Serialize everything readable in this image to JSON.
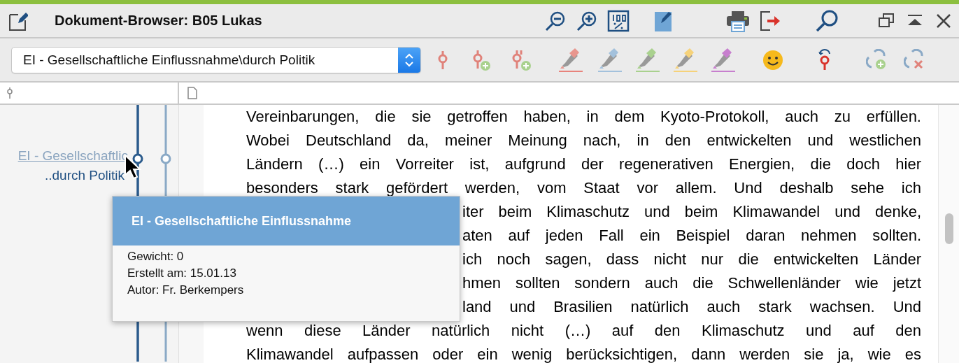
{
  "window": {
    "title": "Dokument-Browser: B05 Lukas"
  },
  "code_selector": {
    "value": "EI - Gesellschaftliche Einflussnahme\\durch Politik"
  },
  "code_stripes": [
    {
      "label": "EI - Gesellschaftlic",
      "kind": "parent"
    },
    {
      "label": "..durch Politik",
      "kind": "child"
    }
  ],
  "document_lines": [
    {
      "text": "Vereinbarungen, die sie getroffen haben, in dem Kyoto-Protokoll, auch zu erfüllen.",
      "kind": "full"
    },
    {
      "text": "Wobei Deutschland da, meiner Meinung nach, in den entwickelten und westlichen",
      "kind": "full"
    },
    {
      "text": "Ländern (…) ein Vorreiter ist, aufgrund der regenerativen Energien, die doch hier",
      "kind": "full"
    },
    {
      "text": "besonders stark gefördert werden, vom Staat vor allem. Und deshalb sehe ich",
      "kind": "full"
    },
    {
      "text": "iter beim Klimaschutz und beim Klimawandel und denke,",
      "kind": "partial"
    },
    {
      "text": "aten auf jeden Fall ein Beispiel daran nehmen sollten.",
      "kind": "partial"
    },
    {
      "text": "ich noch sagen, dass nicht nur die entwickelten Länder",
      "kind": "partial"
    },
    {
      "text": "hmen sollten sondern auch die Schwellenländer wie jetzt",
      "kind": "partial"
    },
    {
      "text": "land und Brasilien natürlich auch stark wachsen. Und",
      "kind": "partial"
    },
    {
      "text": "wenn diese Länder natürlich nicht (…) auf den Klimaschutz und auf den",
      "kind": "full"
    },
    {
      "text": "Klimawandel aufpassen oder ein wenig berücksichtigen, dann werden sie ja, wie es",
      "kind": "full"
    }
  ],
  "tooltip": {
    "title": "EI - Gesellschaftliche Einflussnahme",
    "lines": [
      "Gewicht: 0",
      "Erstellt am: 15.01.13",
      "Autor: Fr. Berkempers"
    ]
  }
}
